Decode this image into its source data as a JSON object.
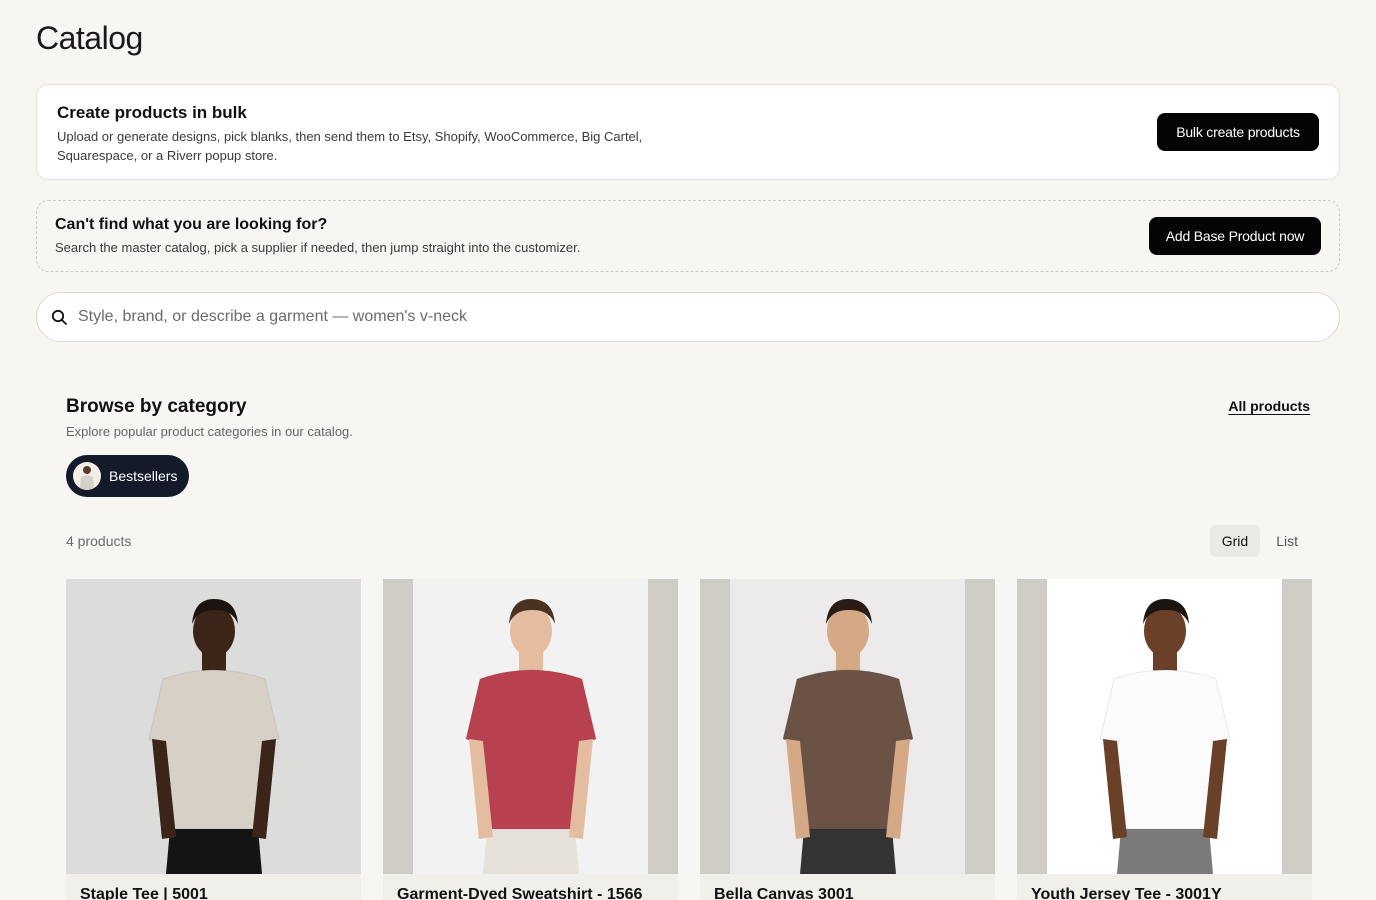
{
  "page": {
    "title": "Catalog"
  },
  "bulk": {
    "title": "Create products in bulk",
    "description": "Upload or generate designs, pick blanks, then send them to Etsy, Shopify, WooCommerce, Big Cartel, Squarespace, or a Riverr popup store.",
    "button": "Bulk create products"
  },
  "find": {
    "title": "Can't find what you are looking for?",
    "description": "Search the master catalog, pick a supplier if needed, then jump straight into the customizer.",
    "button": "Add Base Product now"
  },
  "search": {
    "placeholder": "Style, brand, or describe a garment — women's v-neck",
    "value": ""
  },
  "browse": {
    "title": "Browse by category",
    "subtitle": "Explore popular product categories in our catalog.",
    "all_link": "All products",
    "chip": "Bestsellers"
  },
  "results": {
    "count": "4 products",
    "views": [
      "Grid",
      "List"
    ],
    "active_view": "Grid"
  },
  "products": [
    {
      "name": "Staple Tee | 5001",
      "shirt_color": "#d6d0c6",
      "bg": "#dcdcdb",
      "side": "#dcdcdb",
      "skin": "#3b2519",
      "pants": "#141414",
      "hair": "#1b1410"
    },
    {
      "name": "Garment-Dyed Sweatshirt - 1566",
      "shirt_color": "#b8414f",
      "bg": "#f2f2f2",
      "side": "#cfccc6",
      "skin": "#e4bca0",
      "pants": "#e6e1d8",
      "hair": "#4a3220"
    },
    {
      "name": "Bella Canvas 3001",
      "shirt_color": "#6a5245",
      "bg": "#eceaea",
      "side": "#cfccc6",
      "skin": "#d5a985",
      "pants": "#333333",
      "hair": "#2a1c14"
    },
    {
      "name": "Youth Jersey Tee - 3001Y",
      "shirt_color": "#fbfbfb",
      "bg": "#ffffff",
      "side": "#cfccc6",
      "skin": "#6a4128",
      "pants": "#7a7a7a",
      "hair": "#1c140f"
    }
  ]
}
